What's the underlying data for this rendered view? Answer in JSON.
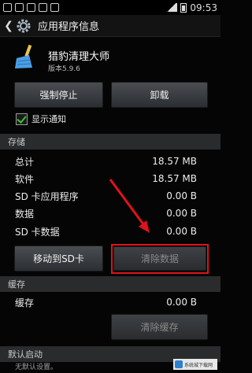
{
  "status": {
    "time": "09:53"
  },
  "actionbar": {
    "title": "应用程序信息"
  },
  "app": {
    "name": "猎豹清理大师",
    "version": "版本5.9.6"
  },
  "buttons": {
    "force_stop": "强制停止",
    "uninstall": "卸载",
    "move_sd": "移动到SD卡",
    "clear_data": "清除数据",
    "clear_cache": "清除缓存"
  },
  "notify": {
    "label": "显示通知",
    "checked": true
  },
  "storage": {
    "header": "存储",
    "rows": [
      {
        "label": "总计",
        "value": "18.57 MB"
      },
      {
        "label": "软件",
        "value": "18.57 MB"
      },
      {
        "label": "SD 卡应用程序",
        "value": "0.00 B"
      },
      {
        "label": "数据",
        "value": "0.00 B"
      },
      {
        "label": "SD 卡数据",
        "value": "0.00 B"
      }
    ]
  },
  "cache": {
    "header": "缓存",
    "label": "缓存",
    "value": "0.00 B"
  },
  "default_launch": {
    "header": "默认启动",
    "subtitle": "无默认设置。"
  },
  "watermark": {
    "text": "系统城下载网"
  },
  "colors": {
    "highlight": "#e0121b",
    "check": "#3ac33a"
  }
}
